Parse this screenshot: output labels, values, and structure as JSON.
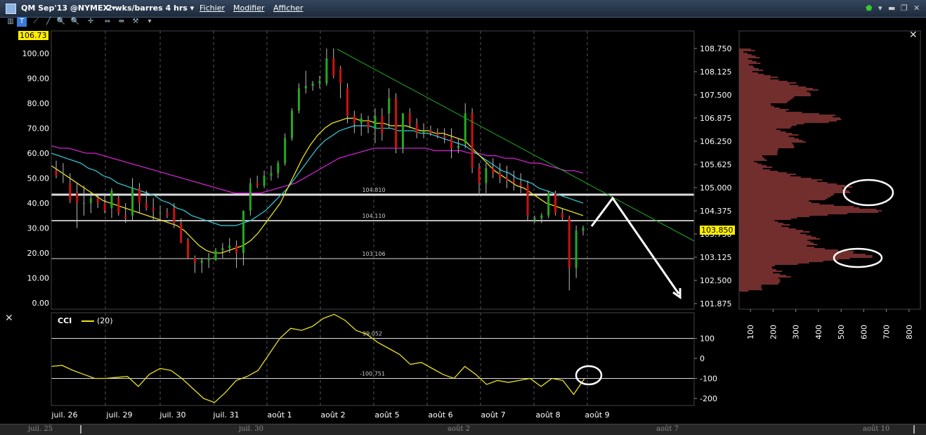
{
  "window": {
    "symbol": "QM Sep'13 @NYMEX ▾",
    "period": "2 wks/barres 4 hrs ▾",
    "menus": [
      "Fichier",
      "Modifier",
      "Afficher"
    ]
  },
  "toolbar": {
    "tools": [
      "bar-chart-icon",
      "text-tool-icon",
      "line-tool-icon",
      "zoom-in-icon",
      "zoom-out-icon",
      "crosshair-icon",
      "scroll-icon",
      "compare-icon",
      "tool-settings-icon",
      "dropdown-icon"
    ]
  },
  "colors": {
    "up": "#22aa22",
    "down": "#cc1111",
    "ma_yellow": "#e8e020",
    "ma_cyan": "#30c0d0",
    "ma_magenta": "#cc22cc",
    "trend": "#22aa22",
    "profile": "#e35a5a",
    "cci": "#e8e020"
  },
  "left_badge": "106.73",
  "price_tag": "103.850",
  "level_labels": [
    "104.810",
    "104.110",
    "103.106"
  ],
  "cci": {
    "title": "CCI",
    "param": "(20)",
    "labels": [
      "99.052",
      "-100.751"
    ]
  },
  "chart_data": [
    {
      "type": "candlestick",
      "y_left_ticks": [
        "100.00",
        "90.00",
        "80.00",
        "70.00",
        "60.00",
        "50.00",
        "40.00",
        "30.00",
        "20.00",
        "10.00",
        "0.00"
      ],
      "y_right_ticks": [
        "108.750",
        "108.125",
        "107.500",
        "106.875",
        "106.250",
        "105.625",
        "105.000",
        "104.375",
        "103.750",
        "103.125",
        "102.500",
        "101.875"
      ],
      "ylim_left": [
        0,
        100
      ],
      "x_labels": [
        "juil. 26",
        "juil. 29",
        "juil. 30",
        "juil. 31",
        "août 1",
        "août 2",
        "août 5",
        "août 6",
        "août 7",
        "août 8",
        "août 9"
      ],
      "candles": [
        {
          "o": 53,
          "h": 57,
          "l": 50,
          "c": 51
        },
        {
          "o": 52,
          "h": 56,
          "l": 48,
          "c": 52
        },
        {
          "o": 48,
          "h": 52,
          "l": 40,
          "c": 41
        },
        {
          "o": 44,
          "h": 48,
          "l": 30,
          "c": 40
        },
        {
          "o": 40,
          "h": 47,
          "l": 35,
          "c": 40
        },
        {
          "o": 40,
          "h": 44,
          "l": 36,
          "c": 42
        },
        {
          "o": 42,
          "h": 43,
          "l": 38,
          "c": 40
        },
        {
          "o": 40,
          "h": 44,
          "l": 36,
          "c": 37
        },
        {
          "o": 38,
          "h": 46,
          "l": 34,
          "c": 45
        },
        {
          "o": 42,
          "h": 44,
          "l": 35,
          "c": 36
        },
        {
          "o": 35,
          "h": 40,
          "l": 32,
          "c": 34
        },
        {
          "o": 35,
          "h": 50,
          "l": 33,
          "c": 46
        },
        {
          "o": 46,
          "h": 48,
          "l": 36,
          "c": 40
        },
        {
          "o": 40,
          "h": 45,
          "l": 37,
          "c": 38
        },
        {
          "o": 38,
          "h": 42,
          "l": 33,
          "c": 37
        },
        {
          "o": 36,
          "h": 39,
          "l": 33,
          "c": 36
        },
        {
          "o": 36,
          "h": 38,
          "l": 34,
          "c": 35
        },
        {
          "o": 38,
          "h": 40,
          "l": 30,
          "c": 32
        },
        {
          "o": 32,
          "h": 34,
          "l": 24,
          "c": 24
        },
        {
          "o": 25,
          "h": 26,
          "l": 18,
          "c": 18
        },
        {
          "o": 18,
          "h": 19,
          "l": 12,
          "c": 16
        },
        {
          "o": 16,
          "h": 18,
          "l": 12,
          "c": 17
        },
        {
          "o": 17,
          "h": 20,
          "l": 14,
          "c": 18
        },
        {
          "o": 17,
          "h": 22,
          "l": 17,
          "c": 21
        },
        {
          "o": 21,
          "h": 24,
          "l": 18,
          "c": 22
        },
        {
          "o": 22,
          "h": 26,
          "l": 20,
          "c": 23
        },
        {
          "o": 23,
          "h": 25,
          "l": 14,
          "c": 20
        },
        {
          "o": 20,
          "h": 35,
          "l": 15,
          "c": 37
        },
        {
          "o": 37,
          "h": 50,
          "l": 35,
          "c": 48
        },
        {
          "o": 48,
          "h": 51,
          "l": 46,
          "c": 47
        },
        {
          "o": 47,
          "h": 53,
          "l": 46,
          "c": 51
        },
        {
          "o": 51,
          "h": 55,
          "l": 49,
          "c": 52
        },
        {
          "o": 52,
          "h": 57,
          "l": 50,
          "c": 56
        },
        {
          "o": 56,
          "h": 68,
          "l": 55,
          "c": 66
        },
        {
          "o": 66,
          "h": 78,
          "l": 65,
          "c": 77
        },
        {
          "o": 77,
          "h": 88,
          "l": 76,
          "c": 86
        },
        {
          "o": 86,
          "h": 93,
          "l": 84,
          "c": 87
        },
        {
          "o": 87,
          "h": 89,
          "l": 85,
          "c": 88
        },
        {
          "o": 88,
          "h": 91,
          "l": 86,
          "c": 89
        },
        {
          "o": 88,
          "h": 102,
          "l": 87,
          "c": 98
        },
        {
          "o": 98,
          "h": 102,
          "l": 90,
          "c": 91
        },
        {
          "o": 94,
          "h": 95,
          "l": 82,
          "c": 88
        },
        {
          "o": 86,
          "h": 88,
          "l": 72,
          "c": 75
        },
        {
          "o": 75,
          "h": 77,
          "l": 68,
          "c": 72
        },
        {
          "o": 72,
          "h": 76,
          "l": 67,
          "c": 74
        },
        {
          "o": 73,
          "h": 75,
          "l": 68,
          "c": 70
        },
        {
          "o": 70,
          "h": 78,
          "l": 64,
          "c": 75
        },
        {
          "o": 75,
          "h": 78,
          "l": 65,
          "c": 68
        },
        {
          "o": 76,
          "h": 86,
          "l": 70,
          "c": 82
        },
        {
          "o": 82,
          "h": 84,
          "l": 60,
          "c": 62
        },
        {
          "o": 62,
          "h": 76,
          "l": 60,
          "c": 76
        },
        {
          "o": 76,
          "h": 78,
          "l": 70,
          "c": 72
        },
        {
          "o": 72,
          "h": 74,
          "l": 66,
          "c": 68
        },
        {
          "o": 68,
          "h": 72,
          "l": 66,
          "c": 69
        },
        {
          "o": 69,
          "h": 71,
          "l": 67,
          "c": 68
        },
        {
          "o": 68,
          "h": 70,
          "l": 66,
          "c": 67
        },
        {
          "o": 67,
          "h": 70,
          "l": 64,
          "c": 66
        },
        {
          "o": 66,
          "h": 70,
          "l": 58,
          "c": 62
        },
        {
          "o": 62,
          "h": 66,
          "l": 60,
          "c": 63
        },
        {
          "o": 64,
          "h": 80,
          "l": 62,
          "c": 76
        },
        {
          "o": 76,
          "h": 78,
          "l": 52,
          "c": 54
        },
        {
          "o": 54,
          "h": 56,
          "l": 43,
          "c": 48
        },
        {
          "o": 48,
          "h": 56,
          "l": 44,
          "c": 54
        },
        {
          "o": 54,
          "h": 58,
          "l": 50,
          "c": 52
        },
        {
          "o": 52,
          "h": 56,
          "l": 48,
          "c": 50
        },
        {
          "o": 50,
          "h": 55,
          "l": 46,
          "c": 49
        },
        {
          "o": 49,
          "h": 53,
          "l": 45,
          "c": 48
        },
        {
          "o": 48,
          "h": 52,
          "l": 44,
          "c": 47
        },
        {
          "o": 47,
          "h": 49,
          "l": 33,
          "c": 35
        },
        {
          "o": 33,
          "h": 35,
          "l": 32,
          "c": 34
        },
        {
          "o": 34,
          "h": 36,
          "l": 32,
          "c": 35
        },
        {
          "o": 35,
          "h": 45,
          "l": 34,
          "c": 44
        },
        {
          "o": 44,
          "h": 45,
          "l": 35,
          "c": 36
        },
        {
          "o": 36,
          "h": 38,
          "l": 33,
          "c": 34
        },
        {
          "o": 34,
          "h": 35,
          "l": 5,
          "c": 14
        },
        {
          "o": 14,
          "h": 31,
          "l": 10,
          "c": 29
        },
        {
          "o": 29,
          "h": 31,
          "l": 27,
          "c": 30
        }
      ],
      "moving_averages": {
        "yellow": [
          55,
          53,
          51,
          49,
          47,
          45,
          43,
          41,
          40,
          39,
          38,
          37,
          36,
          35,
          34,
          33,
          32,
          31,
          29,
          26,
          23,
          21,
          20,
          20,
          21,
          22,
          23,
          25,
          28,
          32,
          36,
          40,
          46,
          52,
          58,
          63,
          67,
          70,
          72,
          73,
          74,
          74,
          73,
          73,
          72,
          72,
          71,
          71,
          71,
          70,
          69,
          69,
          68,
          68,
          67,
          66,
          65,
          62,
          59,
          56,
          53,
          51,
          49,
          47,
          46,
          44,
          42,
          40,
          39,
          38,
          37,
          36,
          35
        ],
        "cyan": [
          60,
          59,
          58,
          57,
          56,
          54,
          53,
          51,
          50,
          48,
          47,
          46,
          45,
          44,
          43,
          41,
          40,
          38,
          37,
          35,
          34,
          33,
          32,
          31,
          31,
          31,
          32,
          33,
          35,
          37,
          40,
          43,
          46,
          50,
          54,
          58,
          62,
          65,
          67,
          69,
          70,
          71,
          71,
          71,
          70,
          70,
          70,
          69,
          69,
          69,
          68,
          68,
          67,
          66,
          65,
          64,
          63,
          61,
          59,
          57,
          55,
          53,
          52,
          50,
          49,
          48,
          46,
          45,
          44,
          43,
          42,
          41,
          40
        ],
        "magenta": [
          63,
          62,
          62,
          61,
          60,
          60,
          59,
          58,
          57,
          56,
          55,
          54,
          53,
          52,
          51,
          50,
          49,
          48,
          47,
          46,
          45,
          44,
          44,
          44,
          44,
          45,
          46,
          47,
          48,
          50,
          52,
          54,
          56,
          58,
          59,
          60,
          61,
          62,
          62,
          62,
          62,
          62,
          62,
          62,
          61,
          61,
          61,
          61,
          60,
          60,
          59,
          59,
          58,
          58,
          57,
          56,
          56,
          55,
          54,
          53,
          53,
          52
        ]
      }
    },
    {
      "type": "bar",
      "title": "volume profile",
      "x_ticks": [
        "100",
        "200",
        "300",
        "400",
        "500",
        "600",
        "700",
        "800"
      ],
      "xlim": [
        50,
        850
      ]
    },
    {
      "type": "line",
      "title": "CCI (20)",
      "y_ticks": [
        "100",
        "0",
        "-100",
        "-200"
      ],
      "ylim": [
        -230,
        175
      ],
      "values": [
        -40,
        -35,
        -60,
        -80,
        -100,
        -100,
        -95,
        -90,
        -140,
        -80,
        -50,
        -60,
        -100,
        -150,
        -200,
        -220,
        -170,
        -110,
        -90,
        -60,
        20,
        100,
        150,
        140,
        160,
        200,
        220,
        190,
        140,
        120,
        80,
        50,
        20,
        -30,
        -20,
        -50,
        -80,
        -100,
        -40,
        -80,
        -130,
        -110,
        -120,
        -110,
        -100,
        -140,
        -100,
        -110,
        -180,
        -100
      ]
    }
  ],
  "scrollbar": {
    "dates": [
      "juil. 25",
      "juil. 30",
      "août 2",
      "août 7",
      "août 10"
    ]
  }
}
